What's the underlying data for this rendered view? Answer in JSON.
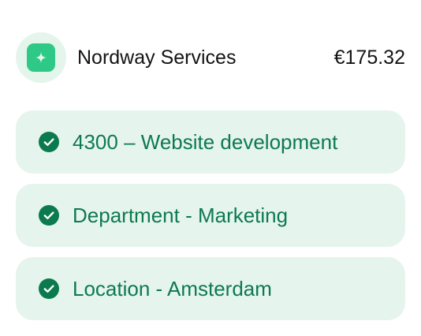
{
  "vendor": {
    "name": "Nordway Services",
    "amount": "€175.32",
    "logo_icon": "clover-logo-icon"
  },
  "colors": {
    "accent": "#0c7a4f",
    "logo": "#2ec987",
    "tag_background": "#e6f4ee"
  },
  "tags": [
    {
      "label": "4300 – Website development",
      "icon": "check-circle-icon"
    },
    {
      "label": "Department - Marketing",
      "icon": "check-circle-icon"
    },
    {
      "label": "Location - Amsterdam",
      "icon": "check-circle-icon"
    }
  ]
}
